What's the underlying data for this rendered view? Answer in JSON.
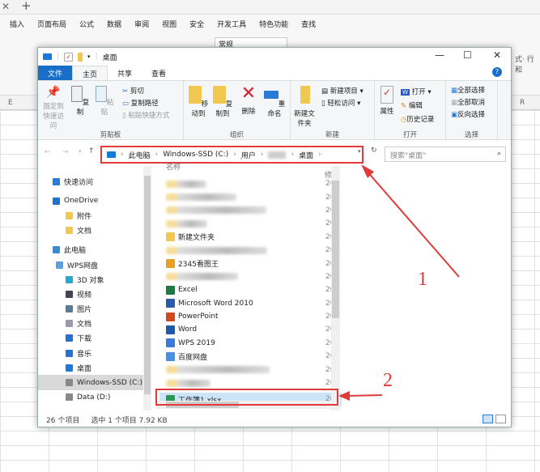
{
  "excel": {
    "menu": [
      "插入",
      "页面布局",
      "公式",
      "数据",
      "审阅",
      "视图",
      "安全",
      "开发工具",
      "特色功能",
      "查找"
    ],
    "number_format": "常规",
    "col_left": "E",
    "col_right": "R",
    "right_tool": "式· 行和"
  },
  "window": {
    "title": "桌面",
    "controls": [
      "—",
      "☐",
      "✕"
    ]
  },
  "ribbon": {
    "tabs": [
      "文件",
      "主页",
      "共享",
      "查看"
    ],
    "clipboard": {
      "pin": "固定到快速访问",
      "copy": "复制",
      "paste": "粘贴",
      "cut": "剪切",
      "copy_path": "复制路径",
      "paste_shortcut": "粘贴快捷方式",
      "label": "剪贴板"
    },
    "organize": {
      "move_to": "移动到",
      "copy_to": "复制到",
      "delete": "删除",
      "rename": "重命名",
      "label": "组织"
    },
    "new": {
      "new_folder": "新建文件夹",
      "new_item": "新建项目",
      "easy_access": "轻松访问",
      "label": "新建"
    },
    "open": {
      "properties": "属性",
      "open": "打开",
      "edit": "编辑",
      "history": "历史记录",
      "label": "打开"
    },
    "select": {
      "select_all": "全部选择",
      "select_none": "全部取消",
      "invert": "反向选择",
      "label": "选择"
    }
  },
  "address": {
    "crumbs": [
      "此电脑",
      "Windows-SSD (C:)",
      "用户",
      "",
      "桌面"
    ],
    "search_placeholder": "搜索\"桌面\""
  },
  "nav": [
    {
      "label": "快速访问",
      "icon": "star-icon",
      "color": "#2a7ad8"
    },
    {
      "label": "OneDrive",
      "icon": "cloud-icon",
      "color": "#1e73d0"
    },
    {
      "label": "附件",
      "icon": "folder-icon",
      "color": "#f0c850"
    },
    {
      "label": "文档",
      "icon": "folder-icon",
      "color": "#f0c850"
    },
    {
      "label": "此电脑",
      "icon": "computer-icon",
      "color": "#3a8ad8"
    },
    {
      "label": "WPS网盘",
      "icon": "cloud-outline-icon",
      "color": "#5aa0e0"
    },
    {
      "label": "3D 对象",
      "icon": "cube-icon",
      "color": "#2aa8c8"
    },
    {
      "label": "视频",
      "icon": "video-icon",
      "color": "#445"
    },
    {
      "label": "图片",
      "icon": "picture-icon",
      "color": "#5a7a9a"
    },
    {
      "label": "文档",
      "icon": "document-icon",
      "color": "#99a"
    },
    {
      "label": "下载",
      "icon": "download-icon",
      "color": "#2a70d0"
    },
    {
      "label": "音乐",
      "icon": "music-icon",
      "color": "#2a70d0"
    },
    {
      "label": "桌面",
      "icon": "desktop-icon",
      "color": "#1a7ad8"
    },
    {
      "label": "Windows-SSD (C:)",
      "icon": "drive-icon",
      "color": "#888"
    },
    {
      "label": "Data (D:)",
      "icon": "drive-icon",
      "color": "#888"
    }
  ],
  "files": {
    "header_name": "名称",
    "header_date": "修",
    "date_text": "20",
    "items": [
      {
        "label": "",
        "blurred": true
      },
      {
        "label": "",
        "blurred": true
      },
      {
        "label": "",
        "blurred": true
      },
      {
        "label": "",
        "blurred": true
      },
      {
        "label": "新建文件夹",
        "color": "#f0c850"
      },
      {
        "label": "",
        "blurred": true
      },
      {
        "label": "2345看图王",
        "color": "#e8a020"
      },
      {
        "label": "",
        "blurred": true
      },
      {
        "label": "Excel",
        "color": "#1d7a45"
      },
      {
        "label": "Microsoft Word 2010",
        "color": "#2b5aa8"
      },
      {
        "label": "PowerPoint",
        "color": "#d04a20"
      },
      {
        "label": "Word",
        "color": "#1e5aa8"
      },
      {
        "label": "WPS 2019",
        "color": "#3a7ad8"
      },
      {
        "label": "百度网盘",
        "color": "#4a90e0"
      },
      {
        "label": "",
        "blurred": true
      },
      {
        "label": "",
        "blurred": true
      },
      {
        "label": "工作簿1.xlsx",
        "color": "#2a9a50",
        "selected": true
      }
    ]
  },
  "status": {
    "count": "26 个项目",
    "selected": "选中 1 个项目  7.92 KB"
  },
  "annotations": {
    "one": "1",
    "two": "2",
    "color": "#e03a3a"
  }
}
